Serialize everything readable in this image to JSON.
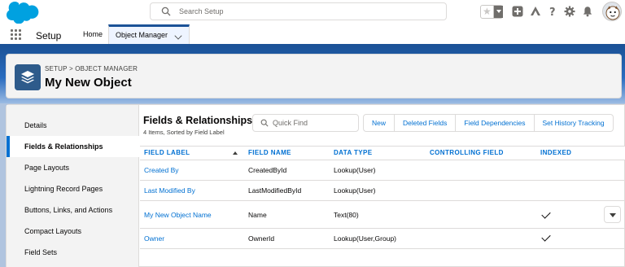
{
  "header": {
    "search_placeholder": "Search Setup",
    "icons": [
      "salesforce-logo",
      "search-icon",
      "favorites-star-icon",
      "add-icon",
      "trailhead-icon",
      "help-icon",
      "gear-icon",
      "notification-bell-icon",
      "avatar"
    ]
  },
  "context": {
    "app_name": "Setup",
    "tabs": [
      {
        "label": "Home"
      },
      {
        "label": "Object Manager"
      }
    ]
  },
  "page": {
    "breadcrumb": "SETUP > OBJECT MANAGER",
    "title": "My New Object"
  },
  "sidebar": {
    "items": [
      {
        "label": "Details"
      },
      {
        "label": "Fields & Relationships"
      },
      {
        "label": "Page Layouts"
      },
      {
        "label": "Lightning Record Pages"
      },
      {
        "label": "Buttons, Links, and Actions"
      },
      {
        "label": "Compact Layouts"
      },
      {
        "label": "Field Sets"
      }
    ],
    "active_index": 1
  },
  "section": {
    "title": "Fields & Relationships",
    "subtitle": "4 Items, Sorted by Field Label",
    "quick_find_placeholder": "Quick Find",
    "buttons": [
      "New",
      "Deleted Fields",
      "Field Dependencies",
      "Set History Tracking"
    ]
  },
  "table": {
    "columns": [
      "FIELD LABEL",
      "FIELD NAME",
      "DATA TYPE",
      "CONTROLLING FIELD",
      "INDEXED"
    ],
    "rows": [
      {
        "label": "Created By",
        "name": "CreatedById",
        "type": "Lookup(User)",
        "controlling": "",
        "indexed": false
      },
      {
        "label": "Last Modified By",
        "name": "LastModifiedById",
        "type": "Lookup(User)",
        "controlling": "",
        "indexed": false
      },
      {
        "label": "My New Object Name",
        "name": "Name",
        "type": "Text(80)",
        "controlling": "",
        "indexed": true
      },
      {
        "label": "Owner",
        "name": "OwnerId",
        "type": "Lookup(User,Group)",
        "controlling": "",
        "indexed": true
      }
    ]
  },
  "colors": {
    "brand_blue": "#0070d2",
    "header_band": "#1b5297",
    "object_icon_bg": "#2e5b8b"
  }
}
